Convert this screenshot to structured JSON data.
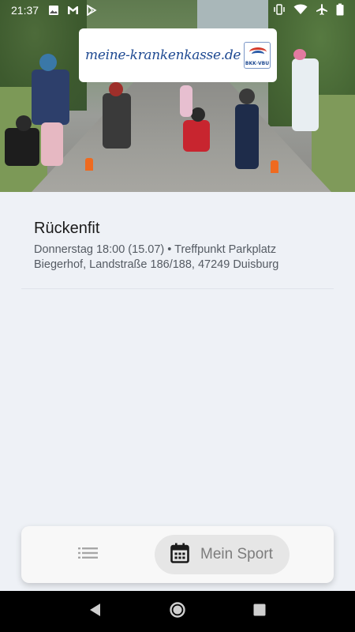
{
  "status_bar": {
    "time": "21:37",
    "left_icons": [
      "image-icon",
      "gmail-icon",
      "play-store-icon"
    ],
    "right_icons": [
      "vibrate-icon",
      "wifi-icon",
      "airplane-icon",
      "battery-icon"
    ]
  },
  "hero": {
    "logo_text": "meine-krankenkasse.de",
    "logo_seal_text": "BKK·VBU"
  },
  "event": {
    "title": "Rückenfit",
    "line1": "Donnerstag 18:00 (15.07)  •  Treffpunkt Parkplatz",
    "line2": "Biegerhof, Landstraße 186/188, 47249 Duisburg"
  },
  "bottom_nav": {
    "items": [
      {
        "icon": "list-icon",
        "label": ""
      },
      {
        "icon": "calendar-icon",
        "label": "Mein Sport"
      }
    ],
    "active_index": 1
  },
  "system_nav": {
    "buttons": [
      "back-icon",
      "home-icon",
      "recents-icon"
    ]
  },
  "colors": {
    "background": "#eef1f6",
    "logo_blue": "#1f4a92",
    "nav_active_bg": "#e6e6e6"
  }
}
